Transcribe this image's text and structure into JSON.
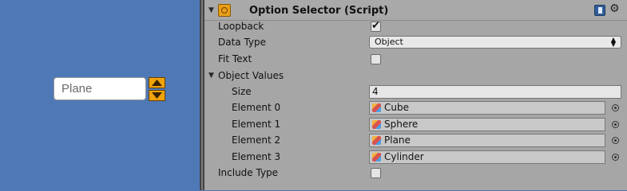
{
  "game_view": {
    "option_text": "Plane",
    "up_icon": "arrow-up-icon",
    "down_icon": "arrow-down-icon",
    "button_color": "#f0a30a"
  },
  "inspector": {
    "component_title": "Option Selector (Script)",
    "script_icon": "script-icon",
    "help_icon": "book-icon",
    "settings_icon": "gear-icon",
    "fields": {
      "loopback": {
        "label": "Loopback",
        "checked": true
      },
      "data_type": {
        "label": "Data Type",
        "value": "Object"
      },
      "fit_text": {
        "label": "Fit Text",
        "checked": false
      },
      "object_values": {
        "label": "Object Values"
      },
      "size": {
        "label": "Size",
        "value": "4"
      },
      "elements": [
        {
          "label": "Element 0",
          "value": "Cube"
        },
        {
          "label": "Element 1",
          "value": "Sphere"
        },
        {
          "label": "Element 2",
          "value": "Plane"
        },
        {
          "label": "Element 3",
          "value": "Cylinder"
        }
      ],
      "include_type": {
        "label": "Include Type",
        "checked": false
      }
    }
  }
}
